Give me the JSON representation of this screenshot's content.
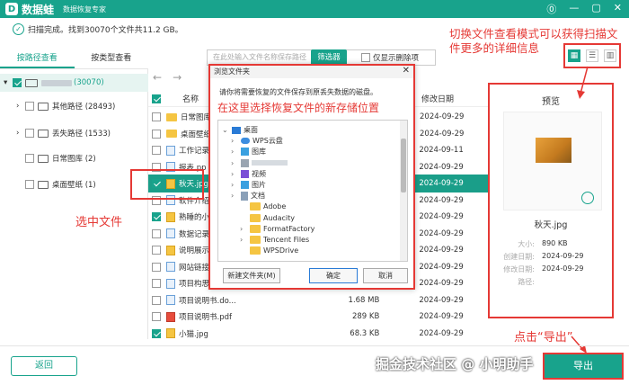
{
  "app": {
    "name": "数据蛙",
    "subtitle": "数据恢复专家",
    "logo": "D"
  },
  "window": {
    "min": "—",
    "max": "▢",
    "close": "✕",
    "help": "⓪"
  },
  "status": {
    "text": "扫描完成。找到30070个文件共11.2 GB。"
  },
  "tabs": [
    "按路径查看",
    "按类型查看"
  ],
  "search": {
    "placeholder": "在此处输入文件名称保存路径",
    "filter_btn": "筛选器",
    "only_deleted": "仅显示删除项"
  },
  "nav": {
    "back": "←",
    "forward": "→"
  },
  "tree": [
    {
      "label": "(30070)",
      "expand": "▾"
    },
    {
      "label": "其他路径 (28493)",
      "expand": "›"
    },
    {
      "label": "丢失路径 (1533)",
      "expand": "›"
    },
    {
      "label": "日常图库 (2)",
      "expand": ""
    },
    {
      "label": "桌面壁纸 (1)",
      "expand": ""
    }
  ],
  "columns": {
    "name": "名称",
    "date": "修改日期"
  },
  "files": [
    {
      "name": "日常图库",
      "size": "",
      "date": "2024-09-29",
      "icon": "folder"
    },
    {
      "name": "桌面壁纸",
      "size": "",
      "date": "2024-09-29",
      "icon": "folder"
    },
    {
      "name": "工作记录1",
      "size": "",
      "date": "2024-09-11",
      "icon": "doc"
    },
    {
      "name": "报表.pp",
      "size": "",
      "date": "2024-09-29",
      "icon": "doc"
    },
    {
      "name": "秋天.jpg",
      "size": "",
      "date": "2024-09-29",
      "icon": "img"
    },
    {
      "name": "软件介绍",
      "size": "",
      "date": "2024-09-29",
      "icon": "doc"
    },
    {
      "name": "熟睡的小猫",
      "size": "",
      "date": "2024-09-29",
      "icon": "img"
    },
    {
      "name": "数据记录表",
      "size": "",
      "date": "2024-09-29",
      "icon": "doc"
    },
    {
      "name": "说明展示.p",
      "size": "",
      "date": "2024-09-29",
      "icon": "img"
    },
    {
      "name": "网站链接.t",
      "size": "",
      "date": "2024-09-29",
      "icon": "doc"
    },
    {
      "name": "项目构思.docx",
      "size": "",
      "date": "2024-09-29",
      "icon": "doc"
    },
    {
      "name": "项目说明书.do...",
      "size": "1.68 MB",
      "date": "2024-09-29",
      "icon": "doc"
    },
    {
      "name": "项目说明书.pdf",
      "size": "289 KB",
      "date": "2024-09-29",
      "icon": "pdf"
    },
    {
      "name": "小猫.jpg",
      "size": "68.3 KB",
      "date": "2024-09-29",
      "icon": "img"
    }
  ],
  "preview": {
    "title": "预览",
    "filename": "秋天.jpg",
    "meta": [
      {
        "k": "大小:",
        "v": "890 KB"
      },
      {
        "k": "创建日期:",
        "v": "2024-09-29"
      },
      {
        "k": "修改日期:",
        "v": "2024-09-29"
      },
      {
        "k": "路径:",
        "v": ""
      }
    ]
  },
  "view_modes": [
    "▦",
    "☰",
    "▥"
  ],
  "dialog": {
    "title": "浏览文件夹",
    "close": "✕",
    "message": "请你将需要恢复的文件保存到原丢失数据的磁盘。",
    "annotation": "在这里选择恢复文件的新存储位置",
    "tree": [
      {
        "label": "桌面",
        "indent": 0,
        "exp": "⌄",
        "kind": "desktop"
      },
      {
        "label": "WPS云盘",
        "indent": 1,
        "exp": "›",
        "kind": "cloud"
      },
      {
        "label": "图库",
        "indent": 1,
        "exp": "›",
        "kind": "pic"
      },
      {
        "label": "",
        "indent": 1,
        "exp": "›",
        "kind": "blur"
      },
      {
        "label": "视频",
        "indent": 1,
        "exp": "›",
        "kind": "video"
      },
      {
        "label": "图片",
        "indent": 1,
        "exp": "›",
        "kind": "pic"
      },
      {
        "label": "文档",
        "indent": 1,
        "exp": "›",
        "kind": "doc"
      },
      {
        "label": "Adobe",
        "indent": 2,
        "exp": "",
        "kind": "folder"
      },
      {
        "label": "Audacity",
        "indent": 2,
        "exp": "",
        "kind": "folder"
      },
      {
        "label": "FormatFactory",
        "indent": 2,
        "exp": "›",
        "kind": "folder"
      },
      {
        "label": "Tencent Files",
        "indent": 2,
        "exp": "›",
        "kind": "folder"
      },
      {
        "label": "WPSDrive",
        "indent": 2,
        "exp": "",
        "kind": "folder"
      }
    ],
    "btn_new": "新建文件夹(M)",
    "btn_ok": "确定",
    "btn_cancel": "取消"
  },
  "annotations": {
    "view_mode": "切换文件查看模式可以获得扫描文件更多的详细信息",
    "select": "选中文件",
    "export": "点击“导出”"
  },
  "buttons": {
    "back": "返回",
    "export": "导出"
  },
  "watermark": "掘金技术社区 @ 小明助手",
  "colors": {
    "brand": "#18a38c",
    "annotation": "#e53935"
  }
}
